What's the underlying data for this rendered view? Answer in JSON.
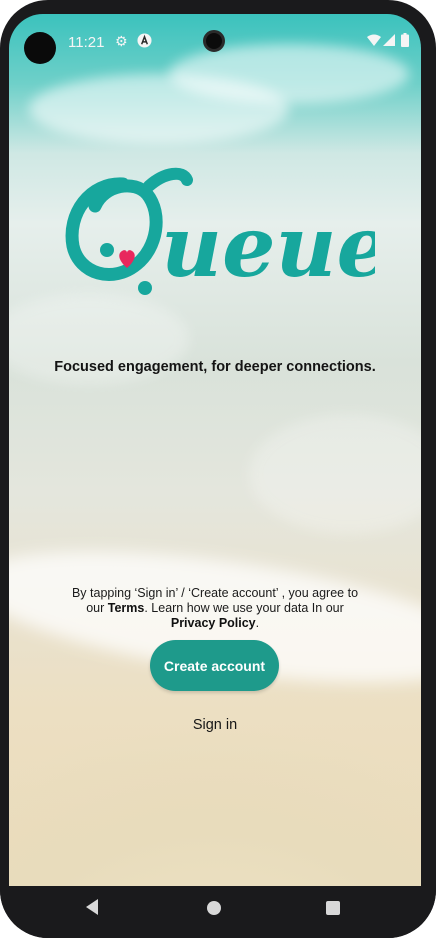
{
  "status_bar": {
    "time": "11:21",
    "icons": [
      "settings-gear-icon",
      "accessibility-a-icon",
      "wifi-icon",
      "signal-icon",
      "battery-icon"
    ]
  },
  "app": {
    "logo_text": "Queue",
    "tagline": "Focused engagement, for deeper connections.",
    "legal": {
      "prefix": "By tapping ‘Sign in’ / ‘Create account’ , you agree to our ",
      "terms": "Terms",
      "middle": ". Learn how we use your data In our ",
      "privacy": "Privacy Policy",
      "suffix": "."
    },
    "create_account_label": "Create account",
    "sign_in_label": "Sign in"
  },
  "colors": {
    "brand_teal": "#1e9a8b",
    "logo_teal": "#17a79d",
    "heart_pink": "#e8275d"
  },
  "nav_bar": {
    "icons": [
      "back-icon",
      "home-icon",
      "recents-icon"
    ]
  }
}
